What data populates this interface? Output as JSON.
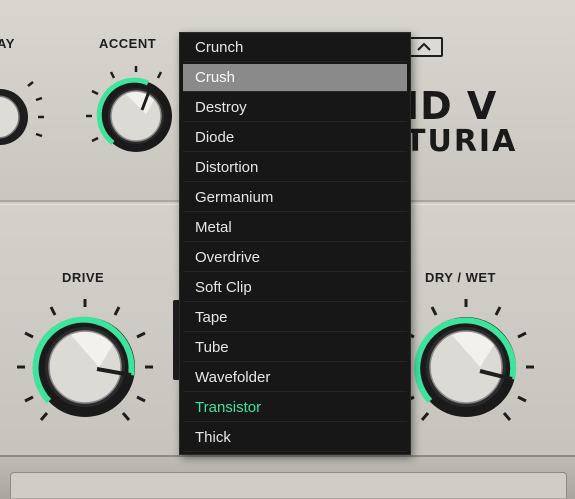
{
  "colors": {
    "accent_green": "#3ee39c",
    "menu_bg": "#171717",
    "menu_hover": "#8a8a8a",
    "panel": "#cfcdc6"
  },
  "labels": {
    "delay_partial": "AY",
    "accent": "ACCENT",
    "drive": "DRIVE",
    "dry_wet": "DRY / WET"
  },
  "brand": {
    "line1": "ID V",
    "line2": "TURIA"
  },
  "distortion_menu": {
    "hovered": "Crush",
    "selected": "Transistor",
    "items": [
      "Crunch",
      "Crush",
      "Destroy",
      "Diode",
      "Distortion",
      "Germanium",
      "Metal",
      "Overdrive",
      "Soft Clip",
      "Tape",
      "Tube",
      "Wavefolder",
      "Transistor",
      "Thick"
    ]
  },
  "icons": {
    "panel_button": "chevron-up-icon"
  }
}
